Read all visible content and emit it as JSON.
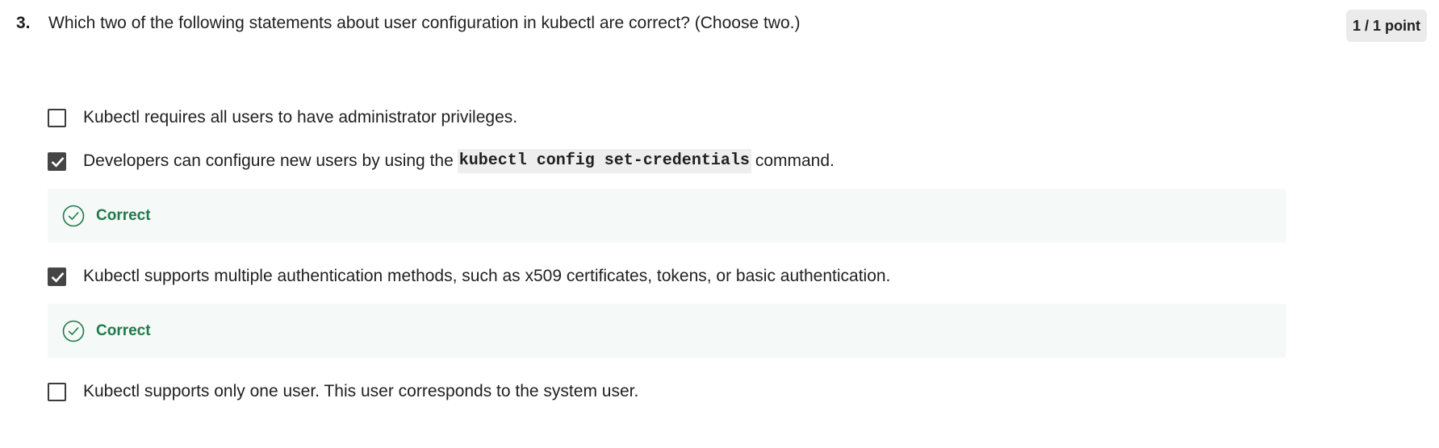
{
  "question": {
    "number": "3.",
    "text": "Which two of the following statements about user configuration in kubectl are correct? (Choose two.)",
    "points": "1 / 1 point"
  },
  "options": [
    {
      "checked": false,
      "text": "Kubectl requires all users to have administrator privileges."
    },
    {
      "checked": true,
      "text_before": "Developers can configure new users by using the",
      "code": "kubectl config set-credentials",
      "text_after": "command.",
      "feedback": "Correct"
    },
    {
      "checked": true,
      "text": "Kubectl supports multiple authentication methods, such as x509 certificates, tokens, or basic authentication.",
      "feedback": "Correct"
    },
    {
      "checked": false,
      "text": "Kubectl supports only one user. This user corresponds to the system user."
    }
  ],
  "icons": {
    "checkmark": "check-icon",
    "feedback": "check-circle-icon"
  },
  "colors": {
    "correct_text": "#1f7a4a",
    "feedback_background": "#f5f9f7",
    "checkbox_checked": "#454545",
    "badge_background": "#ebebeb"
  }
}
